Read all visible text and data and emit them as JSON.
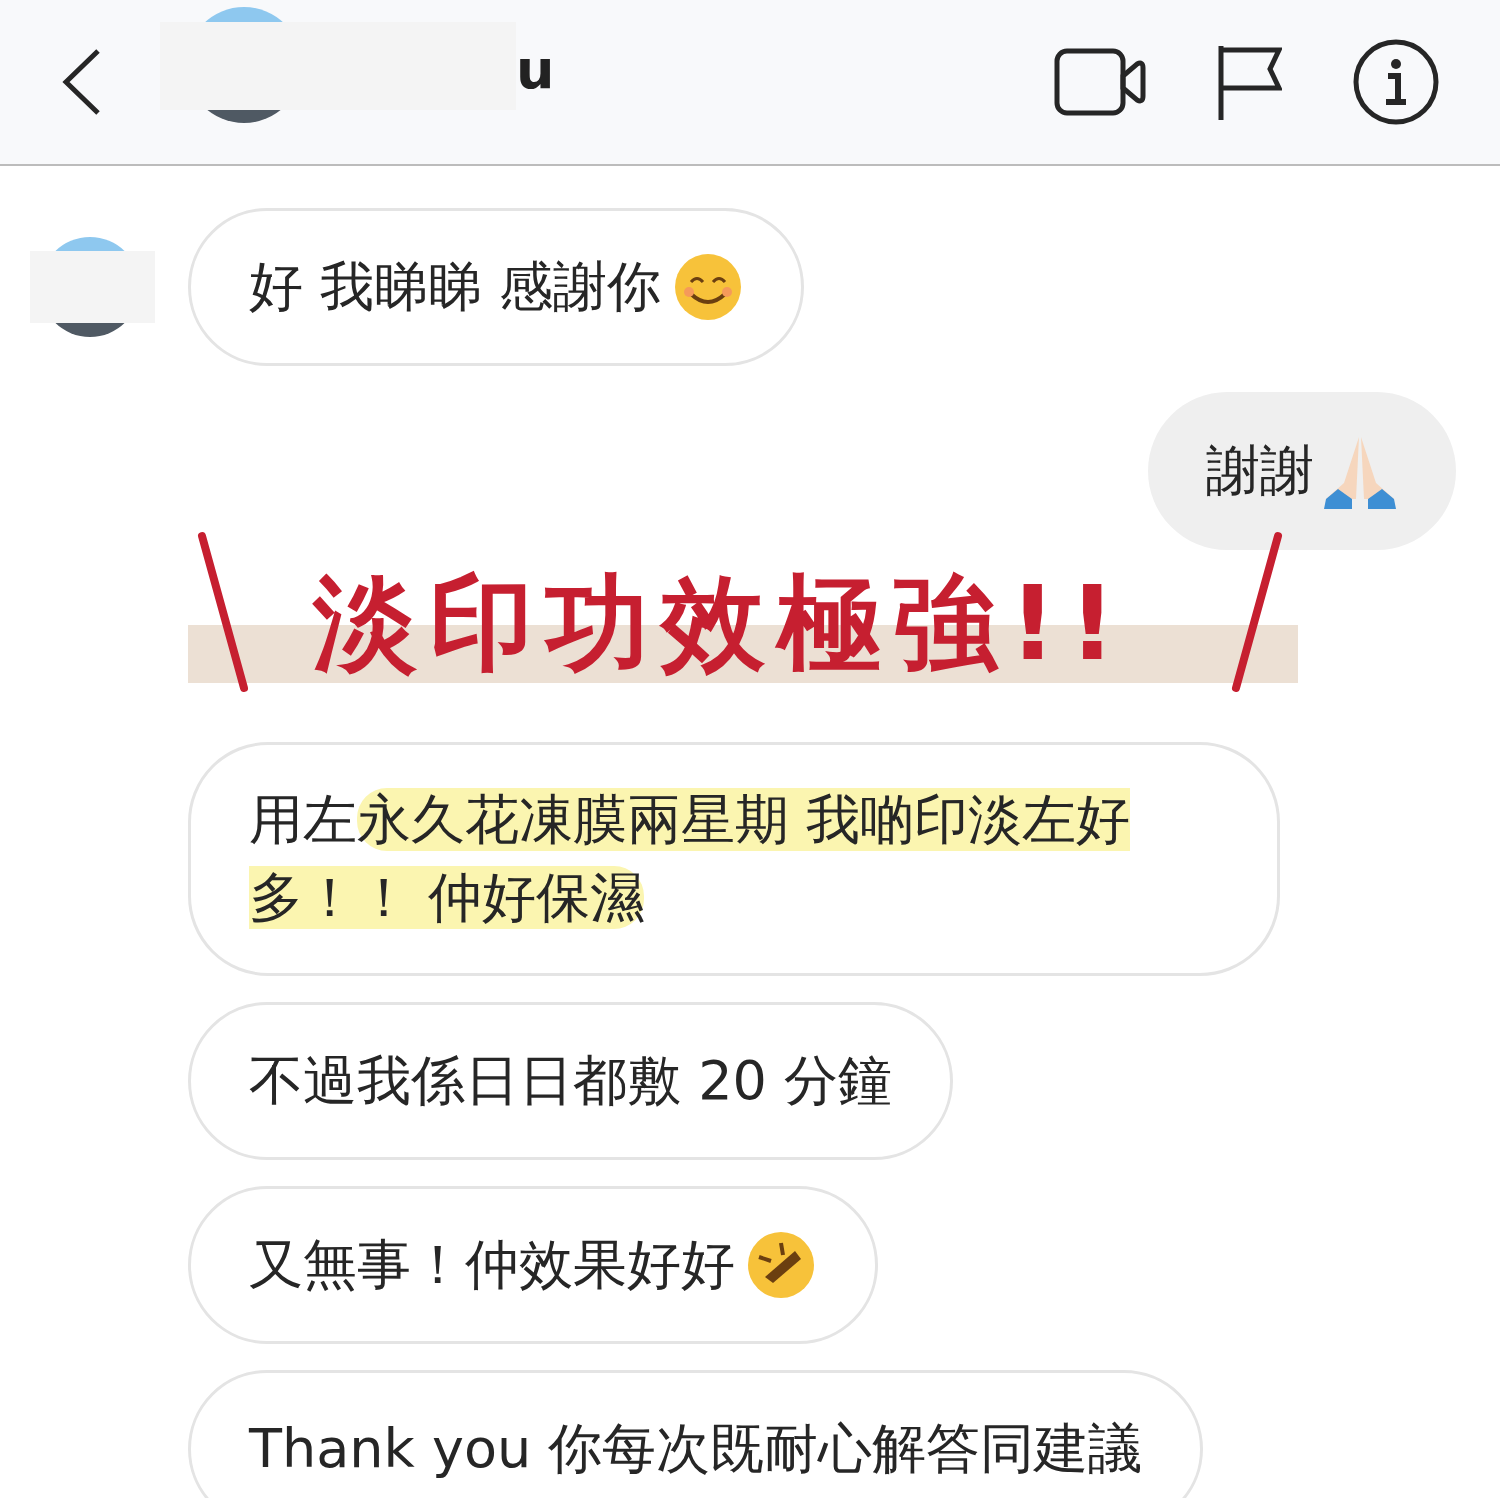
{
  "header": {
    "name": "u"
  },
  "messages": [
    {
      "kind": "received",
      "avatar": true,
      "segments": [
        {
          "text": "好 我睇睇 感謝你",
          "highlighted": false
        }
      ],
      "emoji": {
        "kind": "smile"
      }
    },
    {
      "kind": "sent",
      "avatar": false,
      "segments": [
        {
          "text": "謝謝",
          "highlighted": false
        }
      ],
      "emoji": {
        "kind": "pray"
      }
    },
    {
      "kind": "received",
      "avatar": false,
      "segments": [
        {
          "text": "用左",
          "highlighted": false
        },
        {
          "text": "永久花凍膜兩星期 我啲印淡左好多！！ 仲好保濕",
          "highlighted": true
        }
      ]
    },
    {
      "kind": "received",
      "avatar": false,
      "segments": [
        {
          "text": "不過我係日日都敷 20 分鐘",
          "highlighted": false
        }
      ]
    },
    {
      "kind": "received",
      "avatar": false,
      "segments": [
        {
          "text": "又無事！仲效果好好",
          "highlighted": false
        }
      ],
      "emoji": {
        "kind": "rofl"
      }
    },
    {
      "kind": "received",
      "avatar": false,
      "segments": [
        {
          "text": "Thank you 你每次既耐心解答同建議",
          "highlighted": false
        }
      ]
    }
  ],
  "annotation": {
    "text": "淡印功效極強!!"
  }
}
